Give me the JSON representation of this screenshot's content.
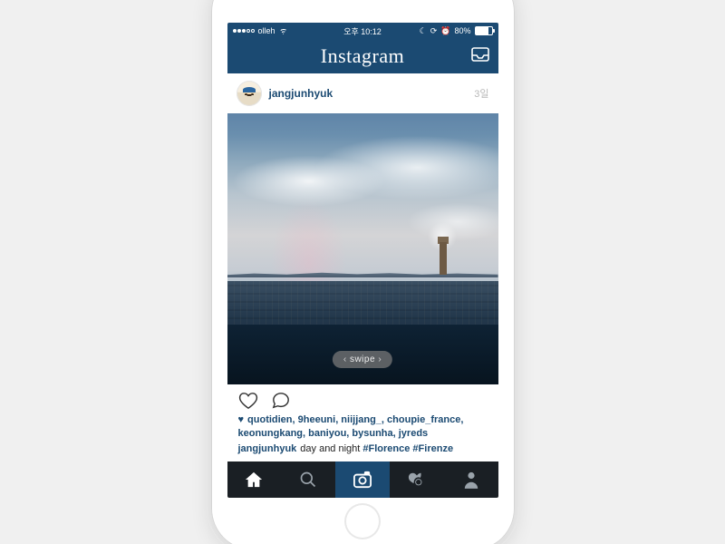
{
  "status_bar": {
    "carrier": "olleh",
    "clock": "오후 10:12",
    "battery_pct": "80%",
    "icons": [
      "signal-dots",
      "wifi-icon",
      "moon-icon",
      "alarm-icon",
      "battery-icon"
    ]
  },
  "nav": {
    "title": "Instagram",
    "right_icon": "inbox-icon"
  },
  "post": {
    "username": "jangjunhyuk",
    "timestamp": "3일",
    "swipe_hint": "swipe",
    "likers": [
      "quotidien",
      "9heeuni",
      "niijjang_",
      "choupie_france",
      "keonungkang",
      "baniyou",
      "bysunha",
      "jyreds"
    ],
    "caption_user": "jangjunhyuk",
    "caption_text": "day and night",
    "caption_hashtags": [
      "#Florence",
      "#Firenze"
    ]
  },
  "tabbar": {
    "items": [
      "home",
      "search",
      "camera",
      "activity",
      "profile"
    ],
    "active_index": 2
  },
  "colors": {
    "brand": "#1b4a72",
    "tabbar_bg": "#1a1f24"
  }
}
